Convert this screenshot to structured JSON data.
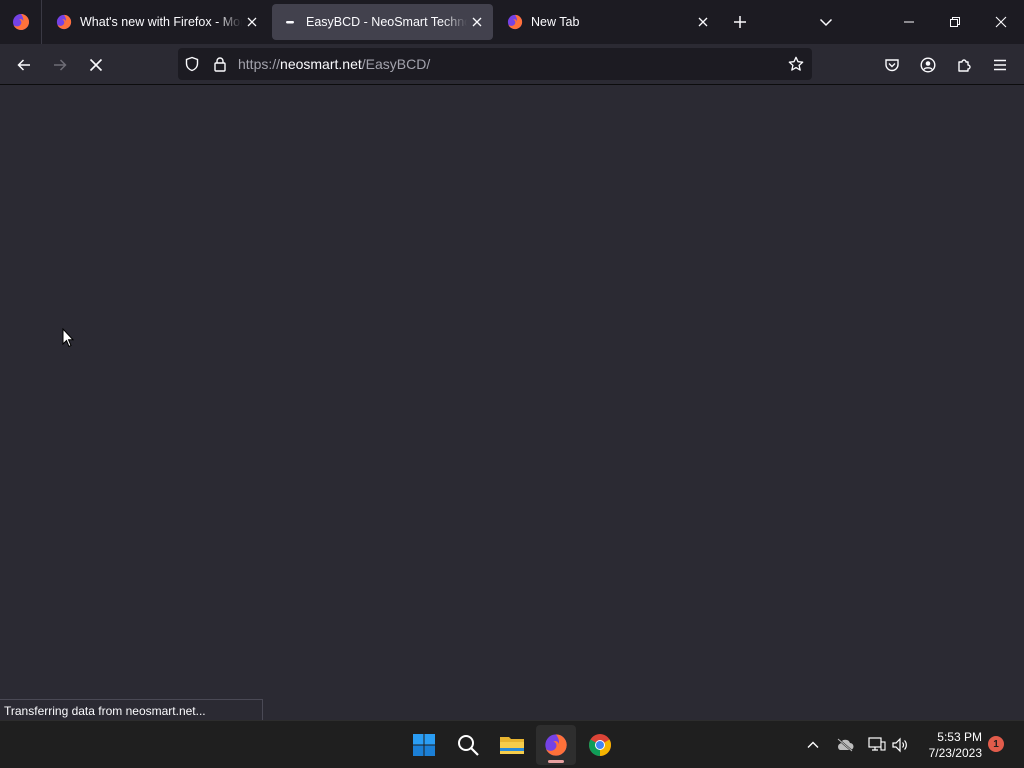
{
  "browser": {
    "tabs": [
      {
        "title": "What's new with Firefox - More",
        "active": false,
        "favicon": "firefox-icon"
      },
      {
        "title": "EasyBCD - NeoSmart Technolog",
        "active": true,
        "favicon": "loading-dots-icon"
      },
      {
        "title": "New Tab",
        "active": false,
        "favicon": "firefox-icon"
      }
    ],
    "url": {
      "scheme": "https://",
      "host": "neosmart.net",
      "path": "/EasyBCD/"
    },
    "status_text": "Transferring data from neosmart.net..."
  },
  "taskbar": {
    "apps": [
      "windows-start-icon",
      "search-icon",
      "file-explorer-icon",
      "firefox-icon",
      "chrome-icon"
    ],
    "clock_time": "5:53 PM",
    "clock_date": "7/23/2023",
    "notification_count": "1"
  },
  "colors": {
    "tabstrip_bg": "#1c1b22",
    "toolbar_bg": "#2b2a33",
    "active_tab_bg": "#42414d",
    "urlbar_bg": "#1c1b22",
    "taskbar_bg": "#1f1f1f"
  }
}
